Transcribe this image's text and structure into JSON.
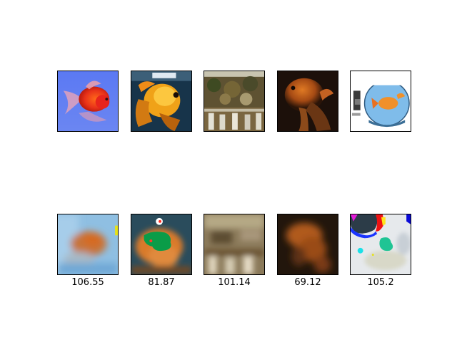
{
  "originals": [
    {
      "name": "goldfish-on-blue-background",
      "colors": {
        "bg": "#5a78f0",
        "fish": "#ef3d14"
      }
    },
    {
      "name": "goldfish-closeup",
      "colors": {
        "bg": "#16344a",
        "fish": "#f2a214"
      }
    },
    {
      "name": "outdoor-scene-with-foliage",
      "colors": {
        "bg": "#6a5d3a",
        "accent": "#d8d6c6"
      }
    },
    {
      "name": "goldfish-dark-background",
      "colors": {
        "bg": "#21120a",
        "fish": "#c2611b"
      }
    },
    {
      "name": "goldfish-in-bowl",
      "colors": {
        "bg": "#ffffff",
        "bowl": "#6fb2e6",
        "fish": "#f08a25"
      }
    }
  ],
  "reconstructions": [
    {
      "name": "blurred-goldfish-blue",
      "score": "106.55",
      "colors": {
        "bg": "#8dbde0",
        "fish": "#c97a3a"
      }
    },
    {
      "name": "goldfish-with-green-patch",
      "score": "81.87",
      "colors": {
        "bg": "#2a4c5c",
        "fish": "#e0802b",
        "patch": "#0aa24a"
      }
    },
    {
      "name": "blurred-outdoor-scene",
      "score": "101.14",
      "colors": {
        "bg": "#8d7b5c",
        "accent": "#d8cdb2"
      }
    },
    {
      "name": "blurred-goldfish-dark",
      "score": "69.12",
      "colors": {
        "bg": "#2a1a10",
        "fish": "#a5541d"
      }
    },
    {
      "name": "noisy-bowl-reconstruction",
      "score": "105.2",
      "colors": {
        "bg": "#e8ebee",
        "patch": "#1fc494",
        "blob": "#2c3c48"
      }
    }
  ]
}
